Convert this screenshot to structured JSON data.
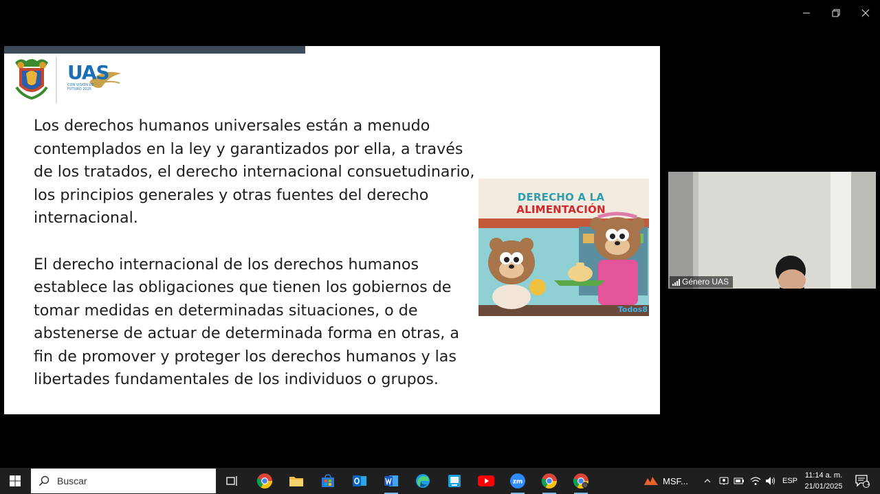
{
  "slide": {
    "logo_text": "UAS",
    "logo_tagline": "CON VISIÓN DE FUTURO 2025",
    "paragraph1": "Los derechos humanos universales están a menudo contemplados en la ley y garantizados por ella, a través de los tratados, el derecho internacional consuetudinario, los principios generales y otras fuentes del derecho internacional.",
    "paragraph2": "El derecho internacional de los derechos humanos establece las obligaciones que tienen los gobiernos de tomar medidas en determinadas situaciones, o de abstenerse de actuar de determinada forma en otras, a fin de promover y proteger los derechos humanos y las libertades fundamentales de los individuos o grupos.",
    "illustration_title_part1": "DERECHO A LA ",
    "illustration_title_part2": "ALIMENTACIÓN",
    "illustration_brand": "Todos8"
  },
  "video": {
    "participant_name": "Género UAS"
  },
  "taskbar": {
    "search_placeholder": "Buscar",
    "running_app_label": "MSF...",
    "language": "ESP",
    "time": "11:14 a. m.",
    "date": "21/01/2025",
    "notification_count": "1"
  },
  "colors": {
    "slide_accent": "#3d4a59",
    "illustration_title": "#2a9fb0",
    "illustration_highlight": "#d6262a",
    "uas_blue": "#1a6fb4"
  }
}
